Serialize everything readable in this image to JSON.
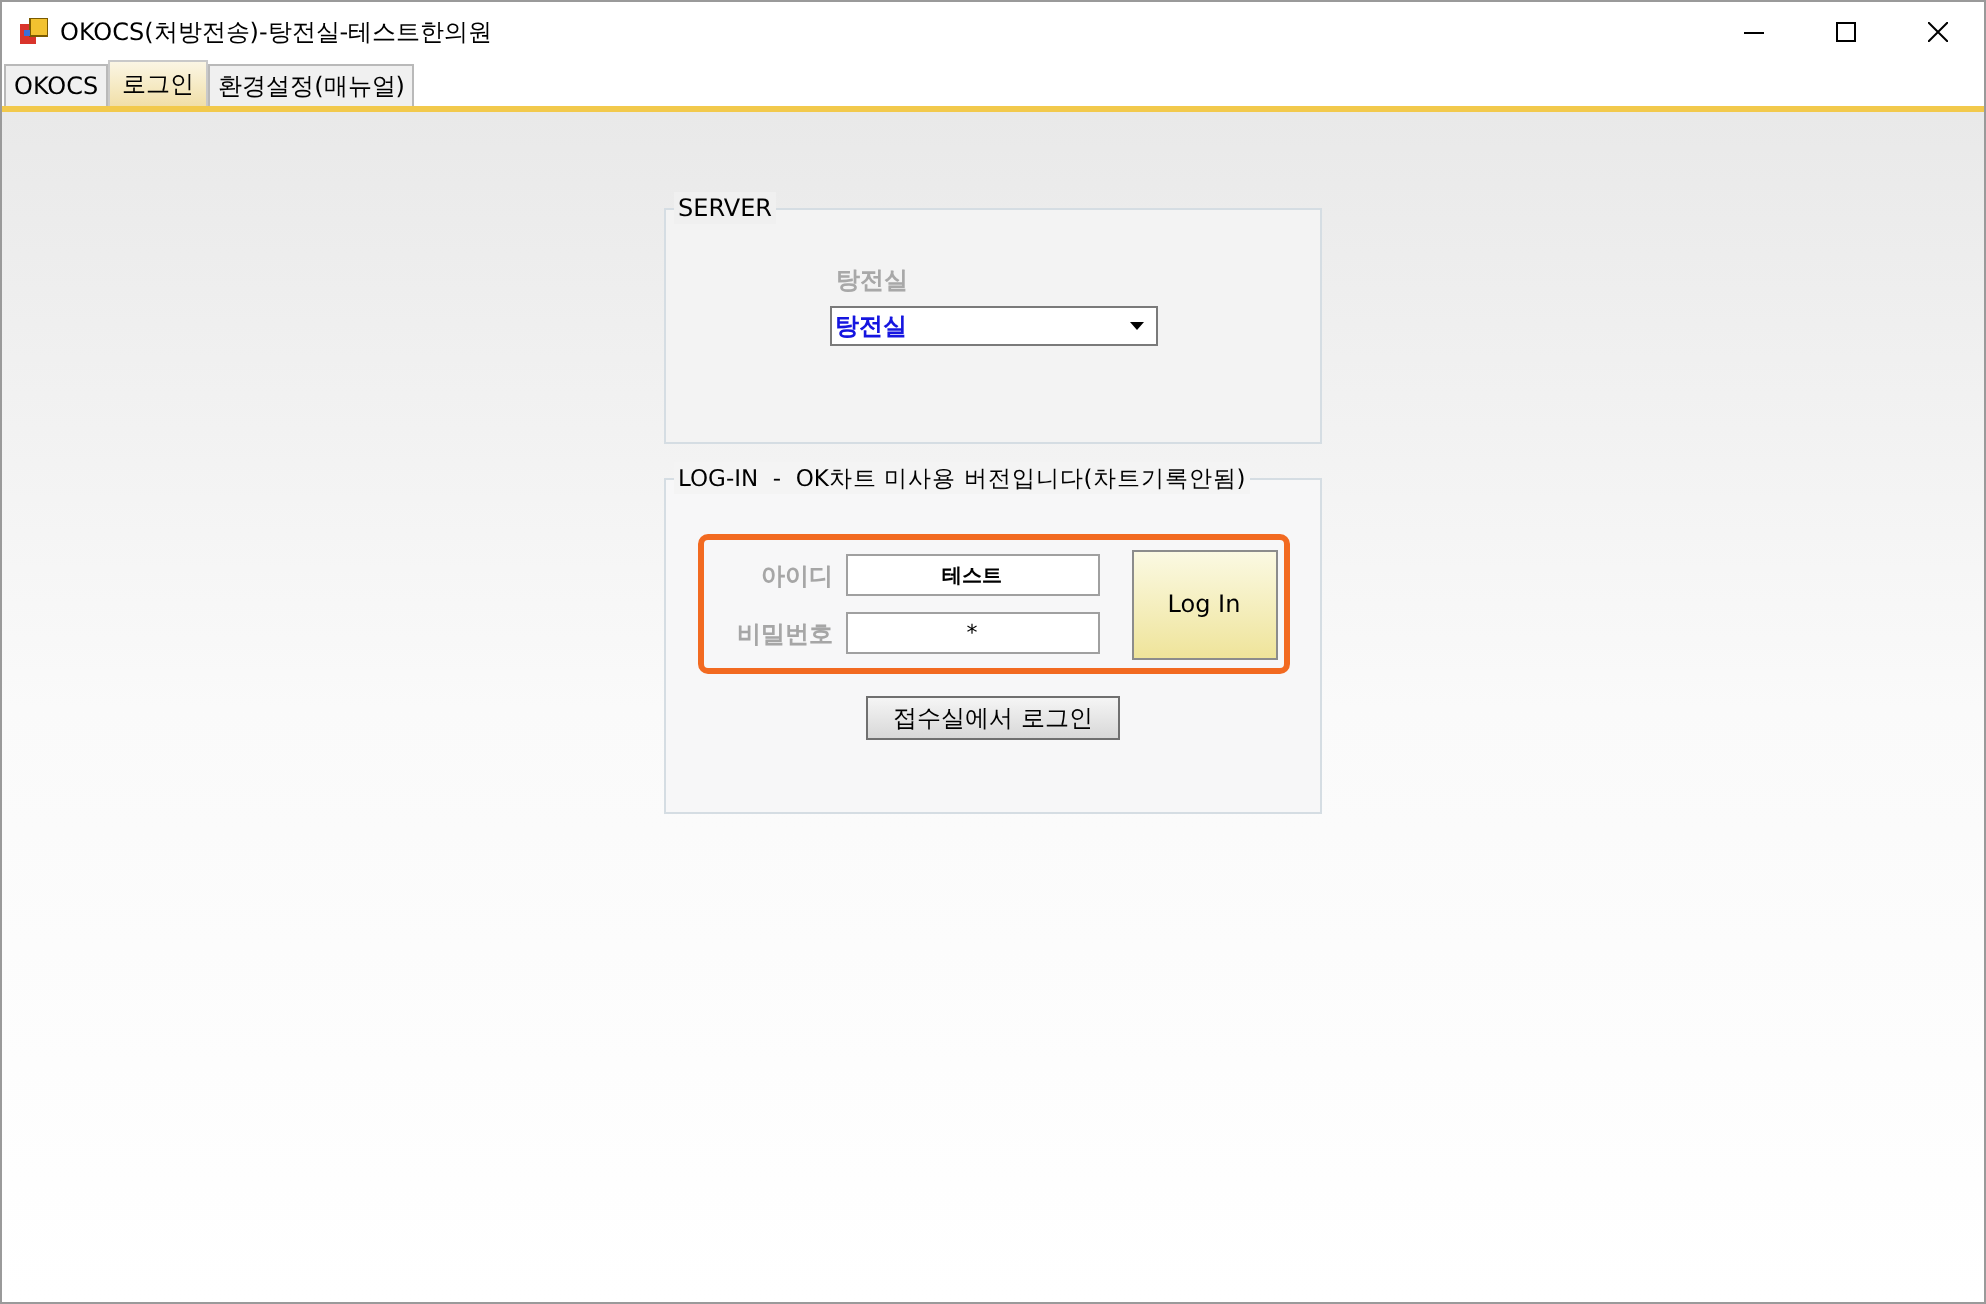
{
  "window": {
    "title": "OKOCS(처방전송)-탕전실-테스트한의원"
  },
  "tabs": [
    {
      "label": "OKOCS",
      "selected": false
    },
    {
      "label": "로그인",
      "selected": true
    },
    {
      "label": "환경설정(매뉴얼)",
      "selected": false
    }
  ],
  "server": {
    "legend": "SERVER",
    "label": "탕전실",
    "dropdown_value": "탕전실"
  },
  "login": {
    "legend": "LOG-IN  -  OK차트 미사용 버전입니다(차트기록안됨)",
    "id_label": "아이디",
    "id_value": "테스트",
    "password_label": "비밀번호",
    "password_value": "*",
    "login_button": "Log In",
    "alt_button": "접수실에서 로그인"
  }
}
